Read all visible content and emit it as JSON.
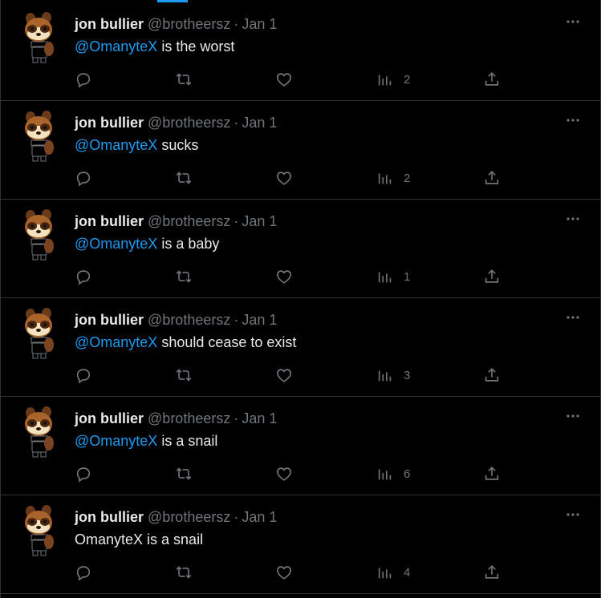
{
  "tweets": [
    {
      "name": "jon bullier",
      "handle": "@brotheersz",
      "sep": "·",
      "date": "Jan 1",
      "mention": "@OmanyteX",
      "text": " is the worst",
      "views": "2"
    },
    {
      "name": "jon bullier",
      "handle": "@brotheersz",
      "sep": "·",
      "date": "Jan 1",
      "mention": "@OmanyteX",
      "text": " sucks",
      "views": "2"
    },
    {
      "name": "jon bullier",
      "handle": "@brotheersz",
      "sep": "·",
      "date": "Jan 1",
      "mention": "@OmanyteX",
      "text": " is a baby",
      "views": "1"
    },
    {
      "name": "jon bullier",
      "handle": "@brotheersz",
      "sep": "·",
      "date": "Jan 1",
      "mention": "@OmanyteX",
      "text": " should cease to exist",
      "views": "3"
    },
    {
      "name": "jon bullier",
      "handle": "@brotheersz",
      "sep": "·",
      "date": "Jan 1",
      "mention": "@OmanyteX",
      "text": " is a snail",
      "views": "6"
    },
    {
      "name": "jon bullier",
      "handle": "@brotheersz",
      "sep": "·",
      "date": "Jan 1",
      "mention": "",
      "text": "OmanyteX is a snail",
      "views": "4"
    }
  ],
  "icons": {
    "more": "more-horizontal-icon",
    "reply": "reply-bubble-icon",
    "retweet": "retweet-icon",
    "like": "heart-icon",
    "views": "views-chart-icon",
    "share": "share-upload-icon"
  },
  "colors": {
    "background": "#000000",
    "text": "#e7e9ea",
    "muted": "#71767b",
    "mention": "#1d9bf0",
    "divider": "#2f3336"
  }
}
